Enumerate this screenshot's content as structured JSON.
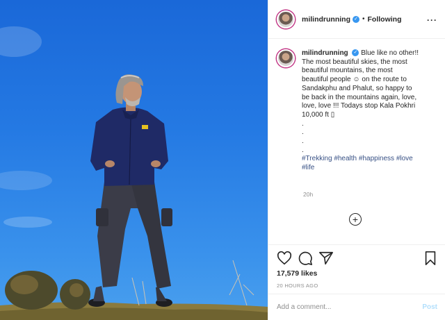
{
  "post": {
    "username": "milindrunning",
    "verified_icon": "verified-badge-icon",
    "separator": "•",
    "follow_status": "Following",
    "more_icon": "more-options-icon",
    "more_label": "···"
  },
  "caption": {
    "username": "milindrunning",
    "lines": [
      "Blue like no other!!",
      "The most beautiful skies, the most",
      "beautiful mountains, the most",
      "beautiful people ☺ on the route to",
      "Sandakphu and Phalut, so happy to",
      "be back in the mountains again, love,",
      "love, love !!! Todays stop Kala Pokhri",
      "10,000 ft ▯"
    ],
    "dots": [
      ".",
      ".",
      ".",
      "."
    ],
    "hashtags_line1": "#Trekking #health #happiness #love",
    "hashtags_line2": "#life",
    "time": "20h"
  },
  "load_more_label": "+",
  "actions": {
    "like_icon": "heart-icon",
    "comment_icon": "comment-icon",
    "share_icon": "share-icon",
    "save_icon": "bookmark-icon"
  },
  "likes": "17,579 likes",
  "age": "20 HOURS AGO",
  "comment": {
    "placeholder": "Add a comment...",
    "value": "",
    "post_label": "Post"
  },
  "colors": {
    "sky": "#2479e3",
    "link": "#385185",
    "post_button": "#b2dffc",
    "muted": "#8e8e8e"
  }
}
